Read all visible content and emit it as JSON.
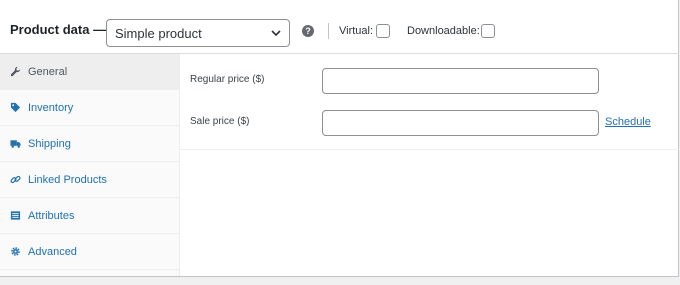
{
  "header": {
    "title": "Product data —",
    "product_type": {
      "selected": "Simple product"
    },
    "help": "?",
    "virtual_label": "Virtual:",
    "virtual_checked": false,
    "downloadable_label": "Downloadable:",
    "downloadable_checked": false
  },
  "tabs": [
    {
      "label": "General",
      "icon": "wrench-icon",
      "active": true
    },
    {
      "label": "Inventory",
      "icon": "tag-icon",
      "active": false
    },
    {
      "label": "Shipping",
      "icon": "truck-icon",
      "active": false
    },
    {
      "label": "Linked Products",
      "icon": "link-icon",
      "active": false
    },
    {
      "label": "Attributes",
      "icon": "list-icon",
      "active": false
    },
    {
      "label": "Advanced",
      "icon": "gear-icon",
      "active": false
    }
  ],
  "general": {
    "regular_price_label": "Regular price ($)",
    "regular_price_value": "",
    "sale_price_label": "Sale price ($)",
    "sale_price_value": "",
    "schedule_label": "Schedule"
  },
  "colors": {
    "link": "#2271b1",
    "active_tab_bg": "#eeeeee",
    "sidebar_bg": "#fafafa"
  }
}
